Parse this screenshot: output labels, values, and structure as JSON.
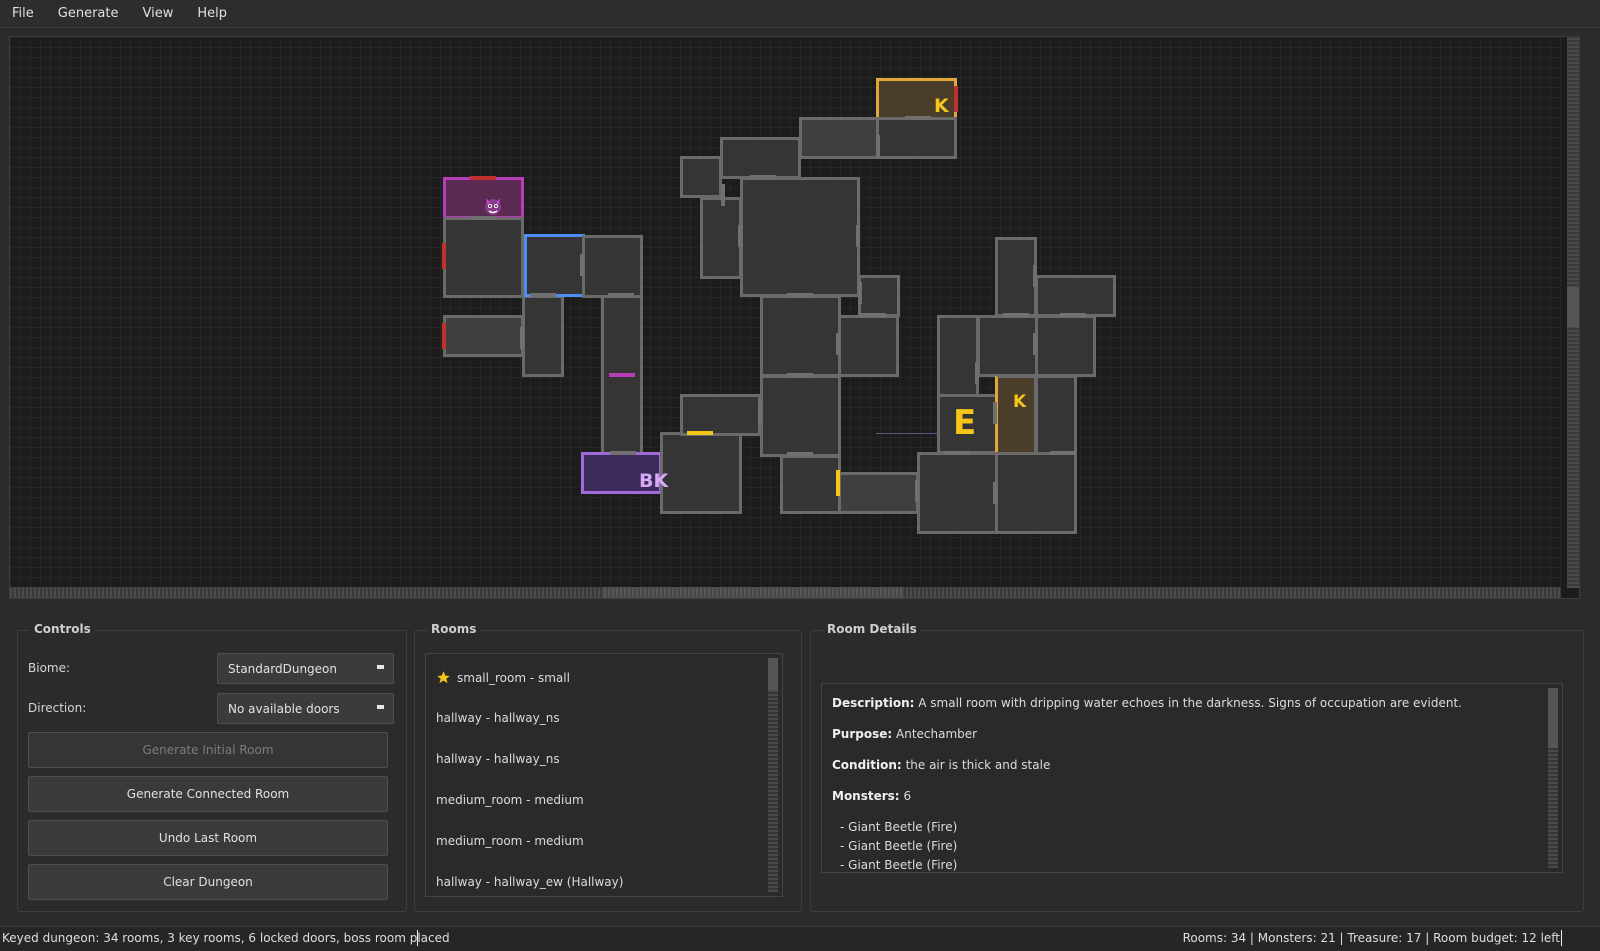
{
  "menu": [
    "File",
    "Generate",
    "View",
    "Help"
  ],
  "map": {
    "marks": {
      "k1": "K",
      "k2": "K",
      "entrance": "E",
      "boss_key": "BK"
    },
    "boss_icon": "demon-face-icon",
    "colors": {
      "key": "#e0a83a",
      "boss": "#b83db8",
      "boss_key": "#a06ad8",
      "selected": "#4f8df2",
      "locked_door": "#c0302e",
      "entrance": "#f5c518"
    }
  },
  "controls": {
    "title": "Controls",
    "biome_label": "Biome:",
    "biome_value": "StandardDungeon",
    "direction_label": "Direction:",
    "direction_value": "No available doors",
    "buttons": {
      "initial": "Generate Initial Room",
      "connected": "Generate Connected Room",
      "undo": "Undo Last Room",
      "clear": "Clear Dungeon"
    }
  },
  "rooms": {
    "title": "Rooms",
    "items": [
      {
        "label": "small_room - small",
        "icon": "star-icon"
      },
      {
        "label": "hallway - hallway_ns"
      },
      {
        "label": "hallway - hallway_ns"
      },
      {
        "label": "medium_room - medium"
      },
      {
        "label": "medium_room - medium"
      },
      {
        "label": "hallway - hallway_ew (Hallway)"
      }
    ]
  },
  "details": {
    "title": "Room Details",
    "description_label": "Description:",
    "description": "A small room with dripping water echoes in the darkness. Signs of occupation are evident.",
    "purpose_label": "Purpose:",
    "purpose": "Antechamber",
    "condition_label": "Condition:",
    "condition": "the air is thick and stale",
    "monsters_label": "Monsters:",
    "monsters_count": "6",
    "monsters": [
      "- Giant Beetle (Fire)",
      "- Giant Beetle (Fire)",
      "- Giant Beetle (Fire)"
    ]
  },
  "status": {
    "left": "Keyed dungeon: 34 rooms, 3 key rooms, 6 locked doors, boss room placed",
    "right": "Rooms: 34 | Monsters: 21 | Treasure: 17 | Room budget: 12 left"
  }
}
